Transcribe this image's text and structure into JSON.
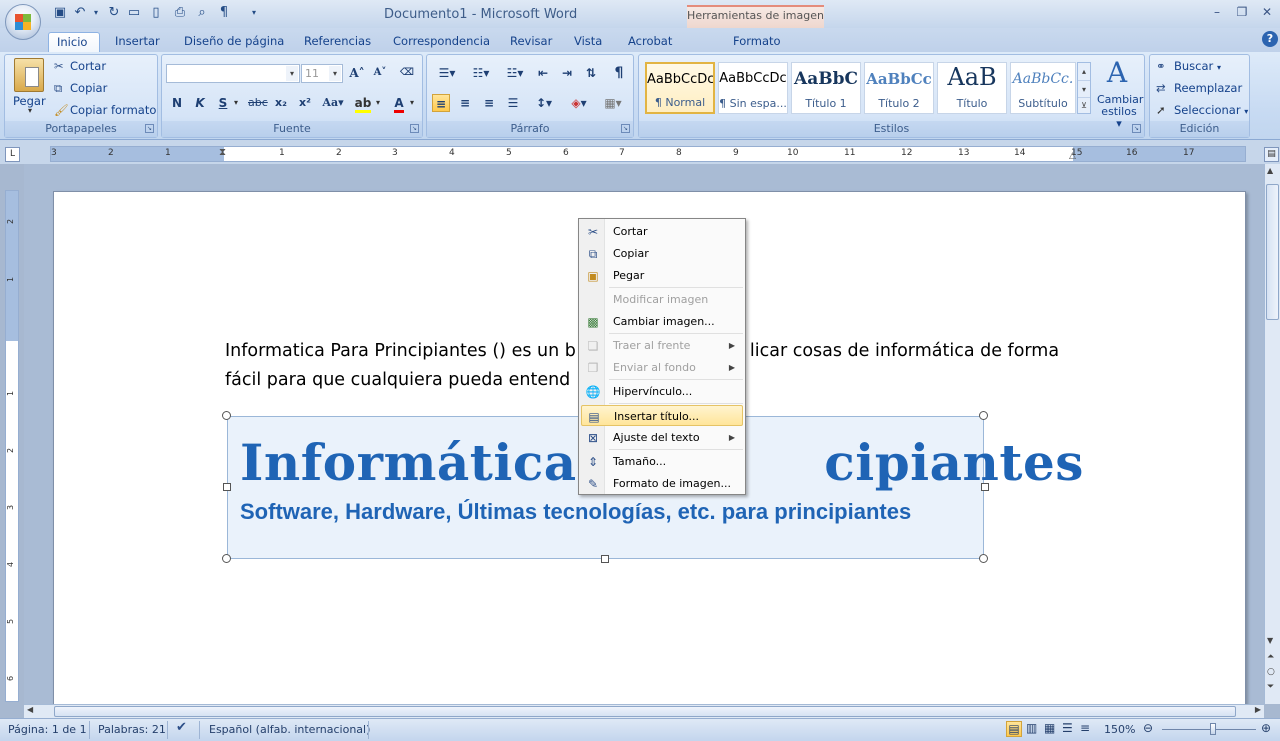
{
  "window": {
    "doc_name": "Documento1",
    "separator": " - ",
    "app_name": "Microsoft Word",
    "context_group": "Herramientas de imagen"
  },
  "tabs": [
    "Inicio",
    "Insertar",
    "Diseño de página",
    "Referencias",
    "Correspondencia",
    "Revisar",
    "Vista",
    "Acrobat",
    "Formato"
  ],
  "ribbon": {
    "clipboard": {
      "caption": "Portapapeles",
      "paste": "Pegar",
      "cut": "Cortar",
      "copy": "Copiar",
      "format_painter": "Copiar formato"
    },
    "font": {
      "caption": "Fuente",
      "font_size": "11"
    },
    "paragraph": {
      "caption": "Párrafo"
    },
    "styles": {
      "caption": "Estilos",
      "items": [
        {
          "sample": "AaBbCcDc",
          "label": "¶ Normal"
        },
        {
          "sample": "AaBbCcDc",
          "label": "¶ Sin espa..."
        },
        {
          "sample": "AaBbC",
          "label": "Título 1"
        },
        {
          "sample": "AaBbCc",
          "label": "Título 2"
        },
        {
          "sample": "AaB",
          "label": "Título"
        },
        {
          "sample": "AaBbCc.",
          "label": "Subtítulo"
        }
      ],
      "change_styles": "Cambiar estilos"
    },
    "editing": {
      "caption": "Edición",
      "find": "Buscar",
      "replace": "Reemplazar",
      "select": "Seleccionar"
    }
  },
  "ruler_numbers": [
    "3",
    "2",
    "1",
    "1",
    "2",
    "3",
    "4",
    "5",
    "6",
    "7",
    "8",
    "9",
    "10",
    "11",
    "12",
    "13",
    "14",
    "15",
    "16",
    "17"
  ],
  "vruler_numbers": [
    "2",
    "1",
    "1",
    "2",
    "3",
    "4",
    "5",
    "6"
  ],
  "document": {
    "paragraph_line1": "Informatica Para Principiantes () es un b",
    "paragraph_line1_b": "licar cosas de informática de forma",
    "paragraph_line2": "fácil para que cualquiera pueda entend",
    "picture_title": "Informática Pa",
    "picture_title_b": "cipiantes",
    "picture_subtitle": "Software, Hardware, Últimas tecnologías, etc. para principiantes"
  },
  "context_menu": [
    {
      "label": "Cortar",
      "icon": "scissors-icon",
      "disabled": false,
      "submenu": false
    },
    {
      "label": "Copiar",
      "icon": "copy-icon",
      "disabled": false,
      "submenu": false
    },
    {
      "label": "Pegar",
      "icon": "paste-icon",
      "disabled": false,
      "submenu": false
    },
    {
      "label": "Modificar imagen",
      "icon": "",
      "disabled": true,
      "submenu": false
    },
    {
      "label": "Cambiar imagen...",
      "icon": "change-picture-icon",
      "disabled": false,
      "submenu": false
    },
    {
      "label": "Traer al frente",
      "icon": "bring-front-icon",
      "disabled": true,
      "submenu": true
    },
    {
      "label": "Enviar al fondo",
      "icon": "send-back-icon",
      "disabled": true,
      "submenu": true
    },
    {
      "label": "Hipervínculo...",
      "icon": "hyperlink-icon",
      "disabled": false,
      "submenu": false
    },
    {
      "label": "Insertar título...",
      "icon": "insert-caption-icon",
      "disabled": false,
      "submenu": false,
      "highlighted": true
    },
    {
      "label": "Ajuste del texto",
      "icon": "text-wrap-icon",
      "disabled": false,
      "submenu": true
    },
    {
      "label": "Tamaño...",
      "icon": "size-icon",
      "disabled": false,
      "submenu": false
    },
    {
      "label": "Formato de imagen...",
      "icon": "format-picture-icon",
      "disabled": false,
      "submenu": false
    }
  ],
  "status": {
    "page": "Página: 1 de 1",
    "words": "Palabras: 21",
    "language": "Español (alfab. internacional)",
    "zoom": "150%"
  },
  "colors": {
    "accent": "#15428b",
    "picture_text": "#1f64b5",
    "menu_highlight": "#ffe59a"
  }
}
